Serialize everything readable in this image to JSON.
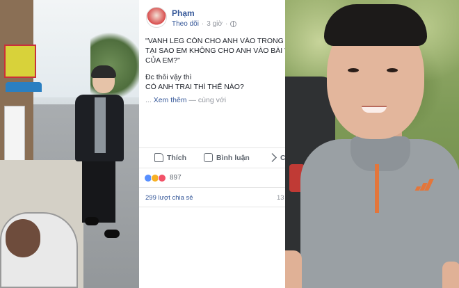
{
  "post": {
    "author": "Phạm",
    "follow_label": "Theo dõi",
    "separator": "·",
    "time": "3 giờ",
    "text_lines": [
      "\"VANH LEG CÒN CHO ANH VÀO TRONG",
      "TẠI SAO EM KHÔNG CHO ANH VÀO BÀI V",
      "CỦA EM?\""
    ],
    "text_lines_2": [
      "Đc thôi vậy thì",
      "CÓ ANH TRAI THÌ THẾ NÀO?"
    ],
    "see_more_prefix": "...",
    "see_more_link": "Xem thêm",
    "see_more_suffix": " — cùng với"
  },
  "actions": {
    "like_label": "Thích",
    "comment_label": "Bình luận",
    "share_label": "C"
  },
  "stats": {
    "reaction_count": "897",
    "share_count": "299 lượt chia sẻ",
    "comment_count": "13"
  },
  "colors": {
    "link": "#365899",
    "text": "#1d2129",
    "muted": "#90949c"
  },
  "icons": {
    "globe": "globe-icon",
    "like": "like-icon",
    "comment": "comment-icon",
    "share": "share-icon"
  }
}
